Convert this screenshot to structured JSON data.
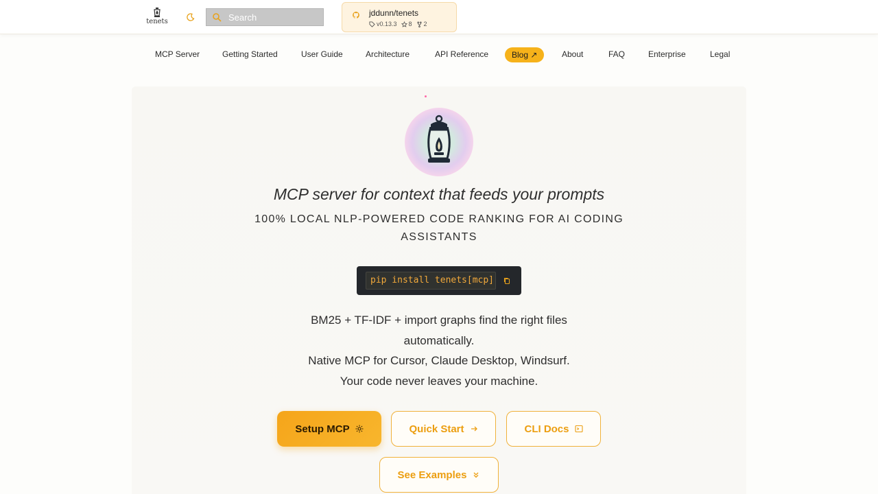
{
  "header": {
    "logo_text": "tenets",
    "search": {
      "placeholder": "Search"
    },
    "repo": {
      "name": "jddunn/tenets",
      "version": "v0.13.3",
      "stars": "8",
      "forks": "2"
    }
  },
  "nav": {
    "items": [
      {
        "label": "MCP Server"
      },
      {
        "label": "Getting Started"
      },
      {
        "label": "User Guide"
      },
      {
        "label": "Architecture"
      },
      {
        "label": "API Reference"
      },
      {
        "label": "Blog ↗"
      },
      {
        "label": "About"
      },
      {
        "label": "FAQ"
      },
      {
        "label": "Enterprise"
      },
      {
        "label": "Legal"
      }
    ]
  },
  "hero": {
    "tagline": "MCP server for context that feeds your prompts",
    "subtitle": "100% LOCAL NLP-POWERED CODE RANKING FOR AI CODING ASSISTANTS",
    "install_command": "pip install tenets[mcp]",
    "description": [
      "BM25 + TF-IDF + import graphs find the right files automatically.",
      "Native MCP for Cursor, Claude Desktop, Windsurf.",
      "Your code never leaves your machine."
    ],
    "buttons": {
      "setup": "Setup MCP",
      "quick_start": "Quick Start",
      "cli_docs": "CLI Docs",
      "examples": "See Examples"
    }
  },
  "colors": {
    "accent": "#f6b21a",
    "accent_text": "#ec9e10",
    "code_bg": "#24272b",
    "code_text": "#f2a93b"
  }
}
